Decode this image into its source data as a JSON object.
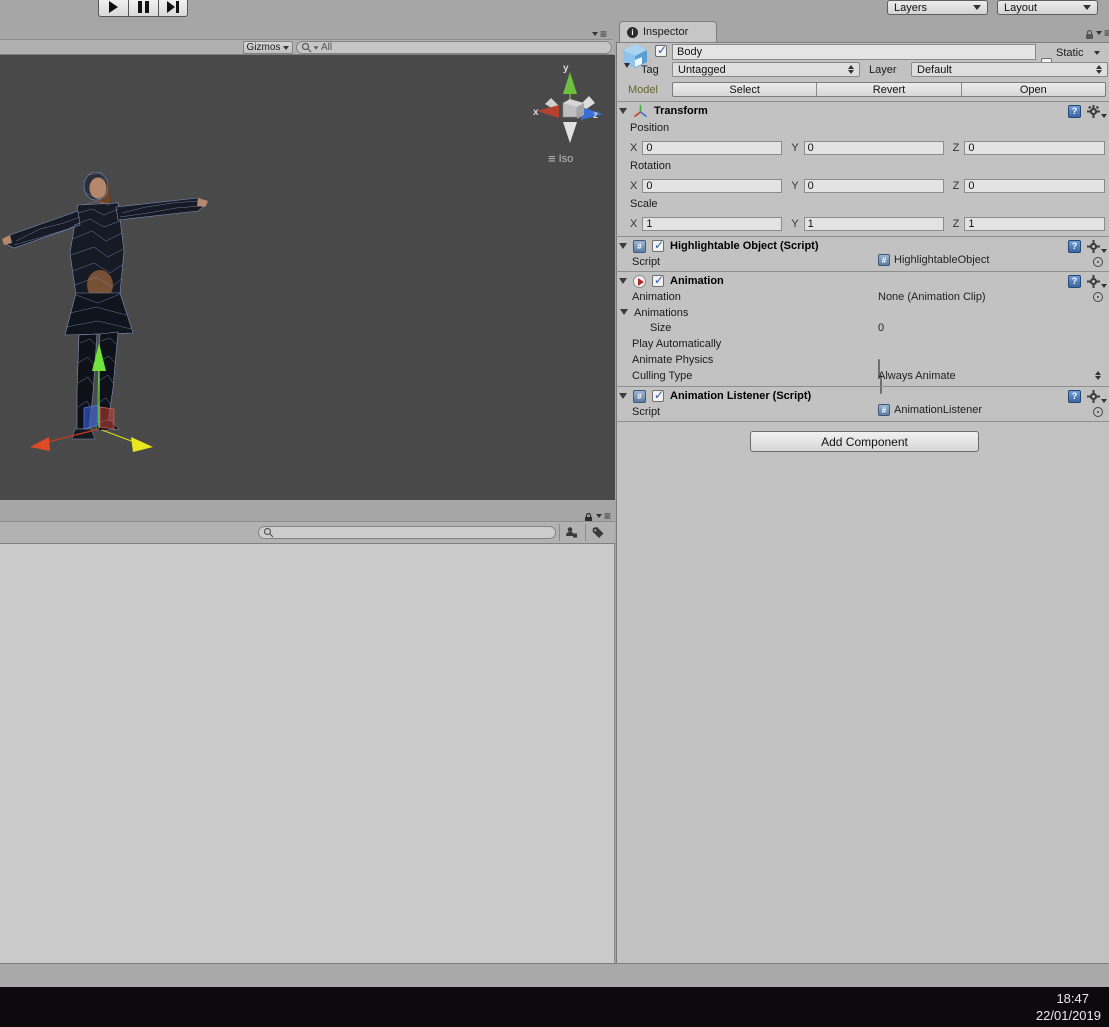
{
  "toolbar": {
    "layers_label": "Layers",
    "layout_label": "Layout"
  },
  "scene": {
    "gizmos_label": "Gizmos",
    "search_value": "All",
    "iso_label": "Iso",
    "axis_labels": {
      "x": "x",
      "y": "y",
      "z": "z"
    },
    "colors": {
      "viewport_bg": "#494949",
      "axis_x": "#b5422f",
      "axis_y": "#6fbf3f",
      "axis_z": "#3a6fd8",
      "gizmo_arrow_y": "#72e23c",
      "gizmo_arrow_x": "#c33b22",
      "gizmo_arrow_z": "#e8e820"
    }
  },
  "inspector": {
    "tab_label": "Inspector",
    "header": {
      "name": "Body",
      "static_label": "Static",
      "tag_label": "Tag",
      "tag_value": "Untagged",
      "layer_label": "Layer",
      "layer_value": "Default",
      "model_label": "Model",
      "select_label": "Select",
      "revert_label": "Revert",
      "open_label": "Open"
    },
    "transform": {
      "title": "Transform",
      "axis": {
        "x": "X",
        "y": "Y",
        "z": "Z"
      },
      "groups": [
        {
          "label": "Position",
          "values": {
            "x": "0",
            "y": "0",
            "z": "0"
          }
        },
        {
          "label": "Rotation",
          "values": {
            "x": "0",
            "y": "0",
            "z": "0"
          }
        },
        {
          "label": "Scale",
          "values": {
            "x": "1",
            "y": "1",
            "z": "1"
          }
        }
      ]
    },
    "highlightable": {
      "title": "Highlightable Object (Script)",
      "script_label": "Script",
      "script_value": "HighlightableObject"
    },
    "animation": {
      "title": "Animation",
      "animation_label": "Animation",
      "animation_value": "None (Animation Clip)",
      "animations_label": "Animations",
      "size_label": "Size",
      "size_value": "0",
      "play_auto_label": "Play Automatically",
      "animate_physics_label": "Animate Physics",
      "culling_label": "Culling Type",
      "culling_value": "Always Animate"
    },
    "listener": {
      "title": "Animation Listener (Script)",
      "script_label": "Script",
      "script_value": "AnimationListener"
    },
    "add_component_label": "Add Component",
    "colors": {
      "panel_bg": "#c2c2c2",
      "model_label": "#66662a"
    }
  },
  "taskbar": {
    "time": "18:47",
    "date": "22/01/2019",
    "bg": "#0d0a0d"
  }
}
